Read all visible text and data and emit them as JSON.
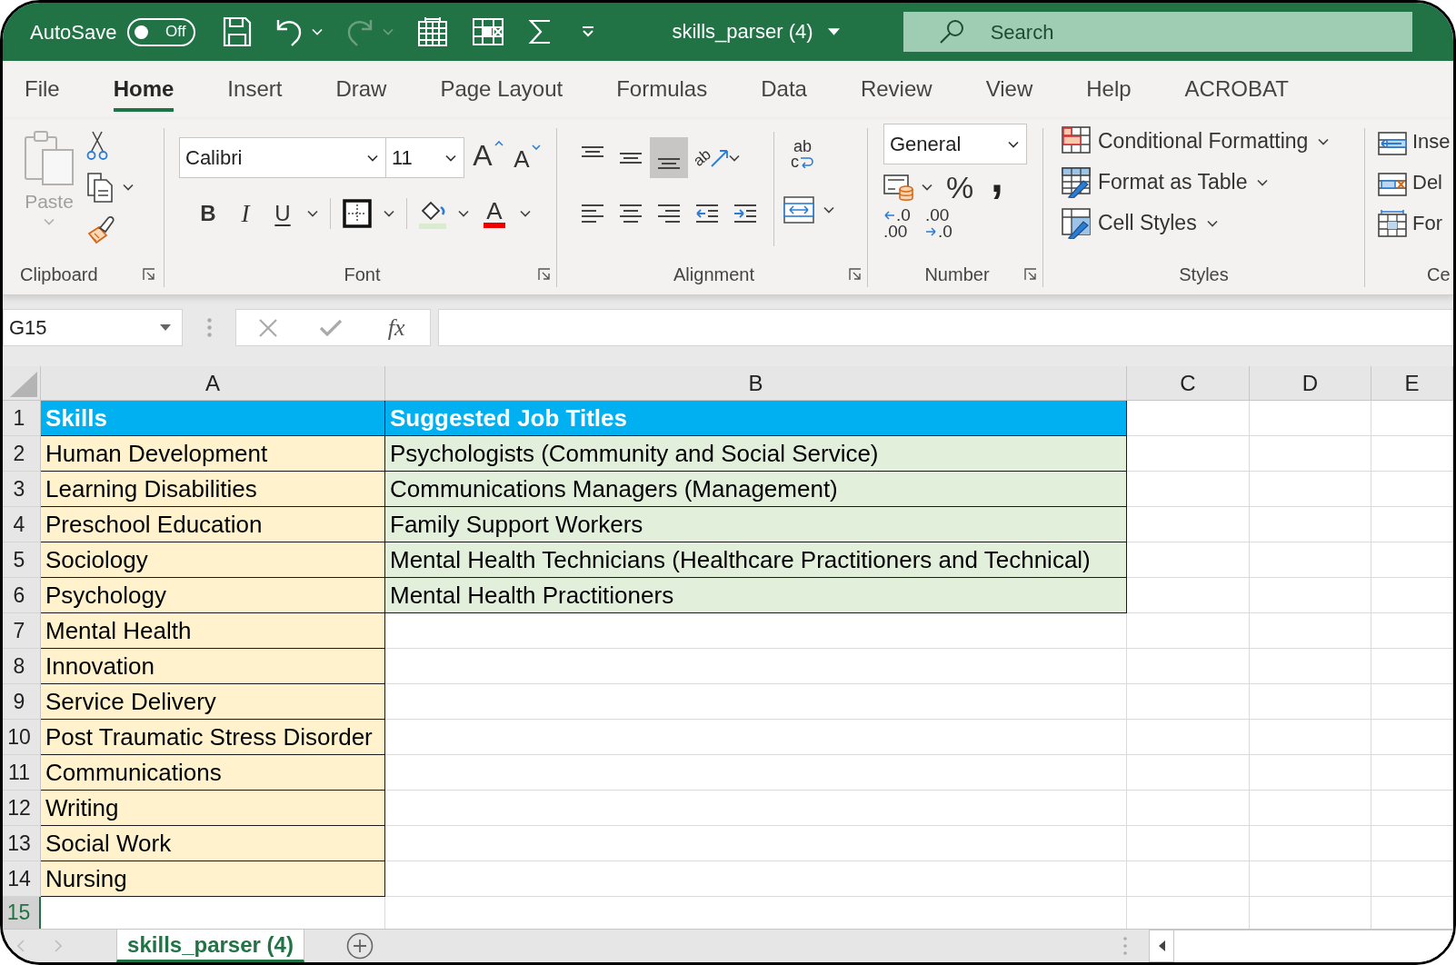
{
  "title_bar": {
    "autosave": {
      "label": "AutoSave",
      "state_text": "Off",
      "on": false
    },
    "quick_access": [
      {
        "kind": "save",
        "menu": false,
        "disabled": false
      },
      {
        "kind": "undo",
        "menu": true,
        "disabled": false
      },
      {
        "kind": "redo",
        "menu": true,
        "disabled": true
      },
      {
        "kind": "grid",
        "menu": false,
        "disabled": false
      },
      {
        "kind": "delete-cells",
        "menu": false,
        "disabled": false
      },
      {
        "kind": "sum",
        "menu": false,
        "disabled": false
      },
      {
        "kind": "customize",
        "menu": false,
        "disabled": false
      }
    ],
    "document_title": "skills_parser (4)",
    "search": {
      "placeholder": "Search"
    }
  },
  "ribbon_tabs": [
    {
      "label": "File",
      "selected": false
    },
    {
      "label": "Home",
      "selected": true
    },
    {
      "label": "Insert",
      "selected": false
    },
    {
      "label": "Draw",
      "selected": false
    },
    {
      "label": "Page Layout",
      "selected": false
    },
    {
      "label": "Formulas",
      "selected": false
    },
    {
      "label": "Data",
      "selected": false
    },
    {
      "label": "Review",
      "selected": false
    },
    {
      "label": "View",
      "selected": false
    },
    {
      "label": "Help",
      "selected": false
    },
    {
      "label": "ACROBAT",
      "selected": false
    }
  ],
  "ribbon": {
    "clipboard": {
      "label": "Clipboard",
      "paste": {
        "label": "Paste",
        "disabled": true
      }
    },
    "font": {
      "label": "Font",
      "font_name": "Calibri",
      "font_size": "11",
      "grow_font": "A",
      "shrink_font": "A",
      "styles": [
        {
          "kind": "bold",
          "text": "B"
        },
        {
          "kind": "italic",
          "text": "I"
        },
        {
          "kind": "underline",
          "text": "U"
        }
      ],
      "font_color": "A"
    },
    "alignment": {
      "label": "Alignment",
      "vertical": [
        {
          "kind": "top",
          "selected": false
        },
        {
          "kind": "middle",
          "selected": false
        },
        {
          "kind": "bottom",
          "selected": true
        }
      ],
      "orientation": "ab",
      "horizontal": [
        {
          "kind": "left"
        },
        {
          "kind": "center"
        },
        {
          "kind": "right"
        },
        {
          "kind": "outdent"
        },
        {
          "kind": "indent"
        }
      ],
      "wrap_text": {
        "top": "ab",
        "bottom": "c"
      }
    },
    "number": {
      "label": "Number",
      "format": "General",
      "percent": "%",
      "comma": ",",
      "increase_decimal": {
        "top": ".0",
        "bottom": ".00"
      },
      "decrease_decimal": {
        "top": ".00",
        "bottom": ".0"
      }
    },
    "styles": {
      "label": "Styles",
      "commands": [
        {
          "kind": "conditional",
          "label": "Conditional Formatting"
        },
        {
          "kind": "table",
          "label": "Format as Table"
        },
        {
          "kind": "cell",
          "label": "Cell Styles"
        }
      ]
    },
    "cells": {
      "label": "Ce",
      "commands": [
        {
          "kind": "insert",
          "label": "Inse"
        },
        {
          "kind": "delete",
          "label": "Del"
        },
        {
          "kind": "format",
          "label": "For"
        }
      ]
    }
  },
  "formula_bar": {
    "name_box": "G15",
    "function_label": "fx"
  },
  "sheet": {
    "columns": [
      {
        "label": "A",
        "selected": false
      },
      {
        "label": "B",
        "selected": false
      },
      {
        "label": "C",
        "selected": false
      },
      {
        "label": "D",
        "selected": false
      },
      {
        "label": "E",
        "selected": false
      }
    ],
    "rows": [
      {
        "number": "1",
        "selected": false,
        "cells": [
          {
            "text": "Skills",
            "kind": "header"
          },
          {
            "text": "Suggested Job Titles",
            "kind": "header"
          }
        ]
      },
      {
        "number": "2",
        "selected": false,
        "cells": [
          {
            "text": "Human Development",
            "kind": "skill"
          },
          {
            "text": "Psychologists (Community and Social Service)",
            "kind": "job"
          }
        ]
      },
      {
        "number": "3",
        "selected": false,
        "cells": [
          {
            "text": "Learning Disabilities",
            "kind": "skill"
          },
          {
            "text": "Communications Managers (Management)",
            "kind": "job"
          }
        ]
      },
      {
        "number": "4",
        "selected": false,
        "cells": [
          {
            "text": "Preschool Education",
            "kind": "skill"
          },
          {
            "text": "Family Support Workers",
            "kind": "job"
          }
        ]
      },
      {
        "number": "5",
        "selected": false,
        "cells": [
          {
            "text": "Sociology",
            "kind": "skill"
          },
          {
            "text": "Mental Health Technicians (Healthcare Practitioners and Technical)",
            "kind": "job"
          }
        ]
      },
      {
        "number": "6",
        "selected": false,
        "cells": [
          {
            "text": "Psychology",
            "kind": "skill"
          },
          {
            "text": "Mental Health Practitioners",
            "kind": "job"
          }
        ]
      },
      {
        "number": "7",
        "selected": false,
        "cells": [
          {
            "text": "Mental Health",
            "kind": "skill"
          }
        ]
      },
      {
        "number": "8",
        "selected": false,
        "cells": [
          {
            "text": "Innovation",
            "kind": "skill"
          }
        ]
      },
      {
        "number": "9",
        "selected": false,
        "cells": [
          {
            "text": "Service Delivery",
            "kind": "skill"
          }
        ]
      },
      {
        "number": "10",
        "selected": false,
        "cells": [
          {
            "text": "Post Traumatic Stress Disorder",
            "kind": "skill"
          }
        ]
      },
      {
        "number": "11",
        "selected": false,
        "cells": [
          {
            "text": "Communications",
            "kind": "skill"
          }
        ]
      },
      {
        "number": "12",
        "selected": false,
        "cells": [
          {
            "text": "Writing",
            "kind": "skill"
          }
        ]
      },
      {
        "number": "13",
        "selected": false,
        "cells": [
          {
            "text": "Social Work",
            "kind": "skill"
          }
        ]
      },
      {
        "number": "14",
        "selected": false,
        "cells": [
          {
            "text": "Nursing",
            "kind": "skill"
          }
        ]
      },
      {
        "number": "15",
        "selected": true
      }
    ]
  },
  "sheet_tabs": [
    {
      "label": "skills_parser (4)",
      "selected": true
    }
  ]
}
